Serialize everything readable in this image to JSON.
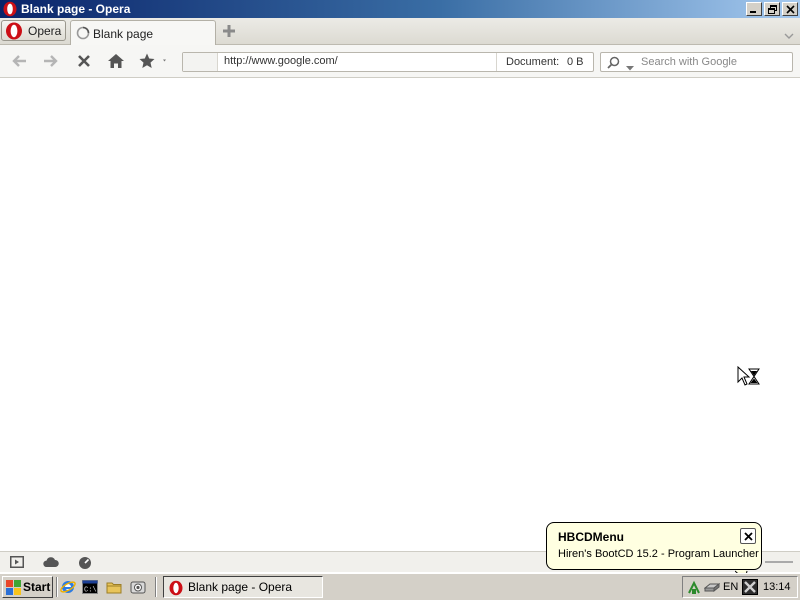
{
  "window": {
    "title": "Blank page - Opera"
  },
  "tabbar": {
    "menu_label": "Opera",
    "tabs": [
      {
        "label": "Blank page",
        "active": true
      }
    ]
  },
  "navbar": {
    "address_value": "http://www.google.com/",
    "document_label": "Document:",
    "document_size": "0 B",
    "search_placeholder": "Search with Google"
  },
  "balloon": {
    "title": "HBCDMenu",
    "text": "Hiren's BootCD 15.2 - Program Launcher"
  },
  "taskbar": {
    "start_label": "Start",
    "task_label": "Blank page - Opera",
    "language": "EN",
    "clock": "13:14"
  },
  "colors": {
    "titlebar_start": "#0a246a",
    "titlebar_end": "#a6caf0",
    "opera_red": "#cc0f16",
    "balloon_bg": "#ffffe1",
    "taskbar_bg": "#d4d0c8"
  }
}
